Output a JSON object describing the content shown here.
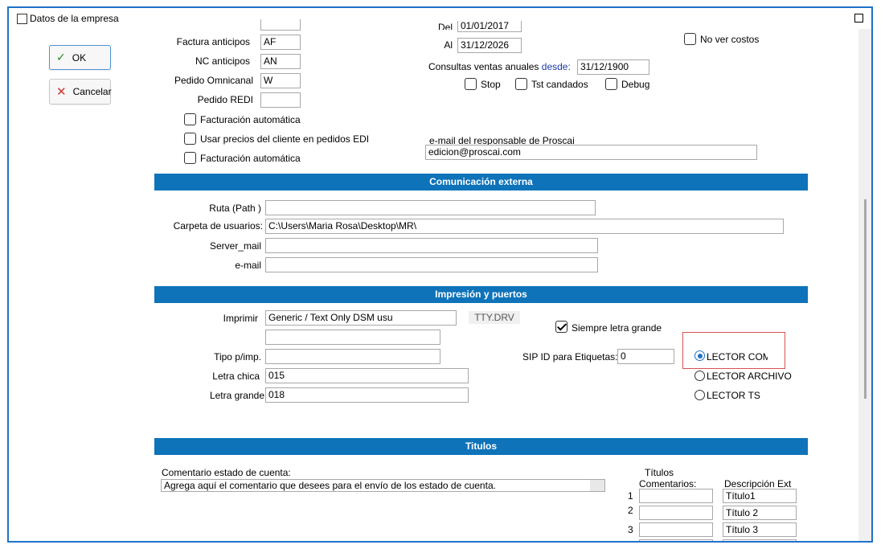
{
  "window": {
    "title": "Datos de la empresa"
  },
  "buttons": {
    "ok": "OK",
    "cancel": "Cancelar"
  },
  "top_fields": {
    "factura_anticipos": {
      "label": "Factura anticipos",
      "value": "AF"
    },
    "nc_anticipos": {
      "label": "NC anticipos",
      "value": "AN"
    },
    "pedido_omnicanal": {
      "label": "Pedido Omnicanal",
      "value": "W"
    },
    "pedido_redi": {
      "label": "Pedido REDI",
      "value": ""
    }
  },
  "dates": {
    "del_label": "Del",
    "del_value": "01/01/2017",
    "al_label": "Al",
    "al_value": "31/12/2026",
    "consultas_label": "Consultas ventas anuales",
    "desde_label": "desde:",
    "desde_value": "31/12/1900"
  },
  "options": {
    "no_ver_costos": "No ver costos",
    "stop": "Stop",
    "tst_candados": "Tst candados",
    "debug": "Debug",
    "facturacion_automatica_1": "Facturación automática",
    "usar_precios": "Usar precios del cliente en pedidos EDI",
    "facturacion_automatica_2": "Facturación automática"
  },
  "email_responsable": {
    "label": "e-mail del responsable de Proscai",
    "value": "edicion@proscai.com"
  },
  "sections": {
    "comunicacion": "Comunicación externa",
    "impresion": "Impresión y puertos",
    "titulos": "Titulos"
  },
  "comunicacion": {
    "ruta": {
      "label": "Ruta (Path )",
      "value": ""
    },
    "carpeta": {
      "label": "Carpeta de usuarios:",
      "value": "C:\\Users\\Maria Rosa\\Desktop\\MR\\"
    },
    "server_mail": {
      "label": "Server_mail",
      "value": ""
    },
    "email": {
      "label": "e-mail",
      "value": ""
    }
  },
  "impresion": {
    "imprimir": {
      "label": "Imprimir",
      "value": "Generic / Text Only  DSM usu",
      "driver": "TTY.DRV",
      "second": ""
    },
    "tipo": {
      "label": "Tipo p/imp.",
      "value": ""
    },
    "letra_chica": {
      "label": "Letra chica",
      "value": "015"
    },
    "letra_grande": {
      "label": "Letra grande",
      "value": "018"
    },
    "siempre_letra_grande": "Siempre letra grande",
    "sip_label": "SIP ID para Etiquetas:",
    "sip_value": "0",
    "lector_com": "LECTOR COM",
    "lector_archivo": "LECTOR ARCHIVO",
    "lector_ts": "LECTOR TS"
  },
  "titulos": {
    "comentario_label": "Comentario estado de cuenta:",
    "comentario_value": "Agrega aquí el comentario que desees para el envío de los estado de cuenta.",
    "col_titulos": "Títulos",
    "col_comentarios": "Comentarios:",
    "col_descripcion": "Descripción Ext",
    "rows": [
      {
        "num": "1",
        "comentario": "",
        "descripcion": "Título1"
      },
      {
        "num": "2",
        "comentario": "",
        "descripcion": "Título 2"
      },
      {
        "num": "3",
        "comentario": "",
        "descripcion": "Título 3"
      }
    ]
  },
  "colors": {
    "accent": "#0e73b9",
    "frame": "#1f72c9",
    "highlight": "#d9534f"
  }
}
